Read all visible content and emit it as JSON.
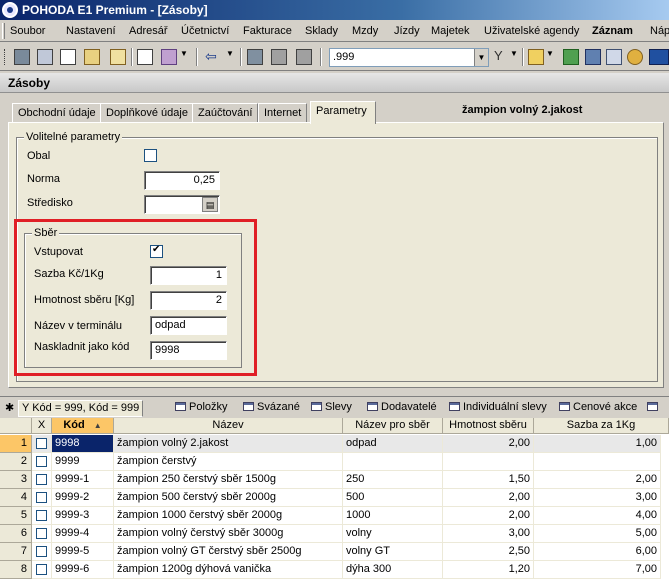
{
  "window": {
    "title": "POHODA E1 Premium - [Zásoby]"
  },
  "menu": [
    "Soubor",
    "Nastavení",
    "Adresář",
    "Účetnictví",
    "Fakturace",
    "Sklady",
    "Mzdy",
    "Jízdy",
    "Majetek",
    "Uživatelské agendy",
    "Záznam",
    "Náp"
  ],
  "toolbar": {
    "search_value": ".999"
  },
  "module_title": "Zásoby",
  "tabs": [
    "Obchodní údaje",
    "Doplňkové údaje",
    "Zaúčtování",
    "Internet",
    "Parametry"
  ],
  "active_tab": "Parametry",
  "item_name": "žampion volný 2.jakost",
  "params": {
    "group_title": "Volitelné parametry",
    "obal_label": "Obal",
    "obal_checked": false,
    "norma_label": "Norma",
    "norma_value": "0,25",
    "stredisko_label": "Středisko",
    "stredisko_value": ""
  },
  "sber": {
    "group_title": "Sběr",
    "vstupovat_label": "Vstupovat",
    "vstupovat_checked": true,
    "sazba_label": "Sazba Kč/1Kg",
    "sazba_value": "1",
    "hmotnost_label": "Hmotnost sběru [Kg]",
    "hmotnost_value": "2",
    "nazev_label": "Název v terminálu",
    "nazev_value": "odpad",
    "kod_label": "Naskladnit jako kód",
    "kod_value": "9998"
  },
  "table_tabs": {
    "filter": "Kód = 999, Kód = 999",
    "items": [
      "Položky",
      "Svázané",
      "Slevy",
      "Dodavatelé",
      "Individuální slevy",
      "Cenové akce"
    ]
  },
  "grid": {
    "headers": {
      "x": "X",
      "kod": "Kód",
      "nazev": "Název",
      "nazev_sber": "Název pro sběr",
      "hmotnost": "Hmotnost sběru",
      "sazba": "Sazba za 1Kg"
    },
    "rows": [
      {
        "n": "1",
        "kod": "9998",
        "nazev": "žampion volný 2.jakost",
        "nazev_sber": "odpad",
        "hmotnost": "2,00",
        "sazba": "1,00"
      },
      {
        "n": "2",
        "kod": "9999",
        "nazev": "žampion čerstvý",
        "nazev_sber": "",
        "hmotnost": "",
        "sazba": ""
      },
      {
        "n": "3",
        "kod": "9999-1",
        "nazev": "žampion 250 čerstvý sběr 1500g",
        "nazev_sber": "250",
        "hmotnost": "1,50",
        "sazba": "2,00"
      },
      {
        "n": "4",
        "kod": "9999-2",
        "nazev": "žampion 500 čerstvý sběr 2000g",
        "nazev_sber": "500",
        "hmotnost": "2,00",
        "sazba": "3,00"
      },
      {
        "n": "5",
        "kod": "9999-3",
        "nazev": "žampion 1000 čerstvý sběr 2000g",
        "nazev_sber": "1000",
        "hmotnost": "2,00",
        "sazba": "4,00"
      },
      {
        "n": "6",
        "kod": "9999-4",
        "nazev": "žampion volný čerstvý sběr 3000g",
        "nazev_sber": "volny",
        "hmotnost": "3,00",
        "sazba": "5,00"
      },
      {
        "n": "7",
        "kod": "9999-5",
        "nazev": "žampion volný GT čerstvý sběr 2500g",
        "nazev_sber": "volny GT",
        "hmotnost": "2,50",
        "sazba": "6,00"
      },
      {
        "n": "8",
        "kod": "9999-6",
        "nazev": "žampion 1200g dýhová vanička",
        "nazev_sber": "dýha 300",
        "hmotnost": "1,20",
        "sazba": "7,00"
      }
    ]
  }
}
